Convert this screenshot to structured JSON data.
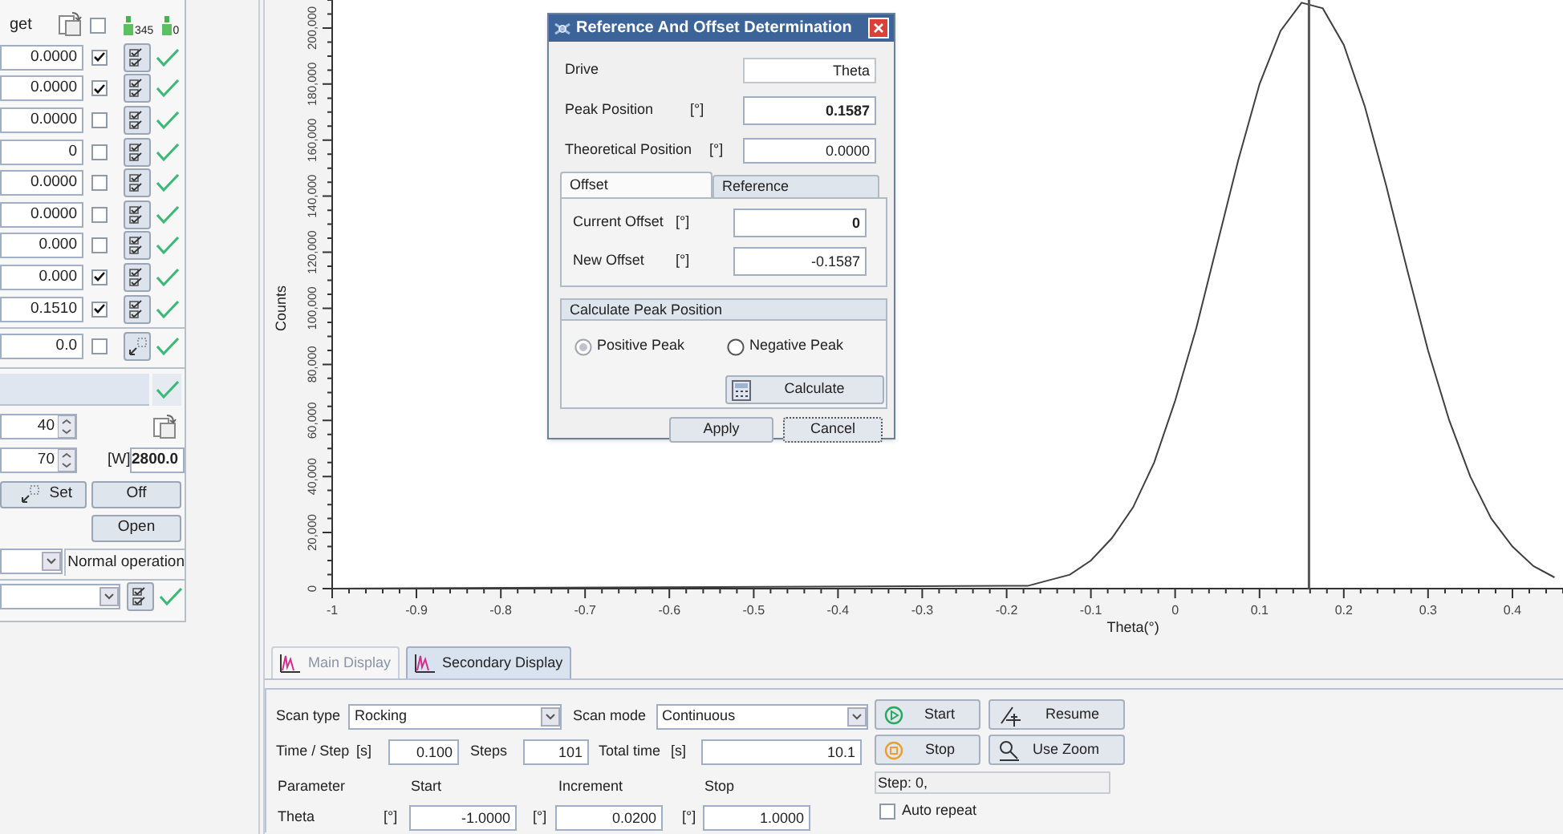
{
  "left_panel": {
    "header": {
      "label": "get",
      "select_all": false,
      "badges": [
        "345",
        "0"
      ]
    },
    "rows": [
      {
        "value": "0.0000",
        "checked": true
      },
      {
        "value": "0.0000",
        "checked": true
      },
      {
        "value": "0.0000",
        "checked": false
      },
      {
        "value": "0",
        "checked": false
      },
      {
        "value": "0.0000",
        "checked": false
      },
      {
        "value": "0.0000",
        "checked": false
      },
      {
        "value": "0.000",
        "checked": false
      },
      {
        "value": "0.000",
        "checked": true
      },
      {
        "value": "0.1510",
        "checked": true
      }
    ],
    "extra_row": {
      "value": "0.0",
      "checked": false
    },
    "spin_a": "40",
    "spin_b": "70",
    "power_unit": "[W]",
    "power": "2800.0",
    "buttons": [
      "Set",
      "Off",
      "Open"
    ],
    "mode_status": "Normal operation"
  },
  "chart": {
    "chart_data": {
      "type": "line",
      "xlabel": "Theta(°)",
      "ylabel": "Counts",
      "x": [
        -1,
        -0.2,
        -0.175,
        -0.15,
        -0.125,
        -0.1,
        -0.075,
        -0.05,
        -0.025,
        0,
        0.025,
        0.05,
        0.075,
        0.1,
        0.125,
        0.15,
        0.175,
        0.2,
        0.225,
        0.25,
        0.275,
        0.3,
        0.325,
        0.35,
        0.375,
        0.4,
        0.425,
        0.45
      ],
      "values": [
        0,
        1000,
        1000,
        3000,
        5000,
        10000,
        18000,
        29000,
        45000,
        67000,
        93000,
        123000,
        153000,
        180000,
        199000,
        209000,
        207000,
        194000,
        172000,
        144000,
        114000,
        85000,
        60000,
        40000,
        25000,
        15000,
        8000,
        4000
      ],
      "xlim": [
        -1,
        0.46
      ],
      "ylim": [
        0,
        210000
      ],
      "xticks": [
        -1,
        -0.9,
        -0.8,
        -0.7,
        -0.6,
        -0.5,
        -0.4,
        -0.3,
        -0.2,
        -0.1,
        0,
        0.1,
        0.2,
        0.3,
        0.4
      ],
      "yticks": [
        {
          "value": 0,
          "label": "0"
        },
        {
          "value": 20000,
          "label": "20,000"
        },
        {
          "value": 40000,
          "label": "40,000"
        },
        {
          "value": 60000,
          "label": "60,000"
        },
        {
          "value": 80000,
          "label": "80,000"
        },
        {
          "value": 100000,
          "label": "100,000"
        },
        {
          "value": 120000,
          "label": "120,000"
        },
        {
          "value": 140000,
          "label": "140,000"
        },
        {
          "value": 160000,
          "label": "160,000"
        },
        {
          "value": 180000,
          "label": "180,000"
        },
        {
          "value": 200000,
          "label": "200,000"
        }
      ],
      "ref_lines": [
        {
          "axis": "x",
          "value": 0.1587
        }
      ]
    }
  },
  "display_tabs": [
    {
      "label": "Main Display",
      "selected": false
    },
    {
      "label": "Secondary Display",
      "selected": true
    }
  ],
  "scan_panel": {
    "scan_type_label": "Scan type",
    "scan_type": "Rocking",
    "scan_mode_label": "Scan mode",
    "scan_mode": "Continuous",
    "time_step_label": "Time / Step",
    "time_unit": "[s]",
    "time_step": "0.100",
    "steps_label": "Steps",
    "steps": "101",
    "total_label": "Total time",
    "total_unit": "[s]",
    "total": "10.1",
    "headers": [
      "Parameter",
      "Start",
      "Increment",
      "Stop"
    ],
    "param": "Theta",
    "units": [
      "[°]",
      "[°]",
      "[°]"
    ],
    "start": "-1.0000",
    "increment": "0.0200",
    "stop": "1.0000",
    "buttons": [
      "Start",
      "Resume",
      "Stop",
      "Use Zoom"
    ],
    "status": "Step: 0,",
    "auto_repeat_label": "Auto repeat",
    "auto_repeat": false
  },
  "dialog": {
    "title": "Reference And Offset Determination",
    "drive_label": "Drive",
    "drive": "Theta",
    "peak_label": "Peak Position",
    "peak_unit": "[°]",
    "peak": "0.1587",
    "theo_label": "Theoretical Position",
    "theo_unit": "[°]",
    "theo": "0.0000",
    "tabs": [
      {
        "label": "Offset",
        "selected": true
      },
      {
        "label": "Reference",
        "selected": false
      }
    ],
    "current_label": "Current Offset",
    "current_unit": "[°]",
    "current": "0",
    "new_label": "New Offset",
    "new_unit": "[°]",
    "new": "-0.1587",
    "group_title": "Calculate Peak Position",
    "peaks": [
      {
        "label": "Positive Peak",
        "selected": true
      },
      {
        "label": "Negative Peak",
        "selected": false
      }
    ],
    "calculate": "Calculate",
    "apply": "Apply",
    "cancel": "Cancel"
  }
}
